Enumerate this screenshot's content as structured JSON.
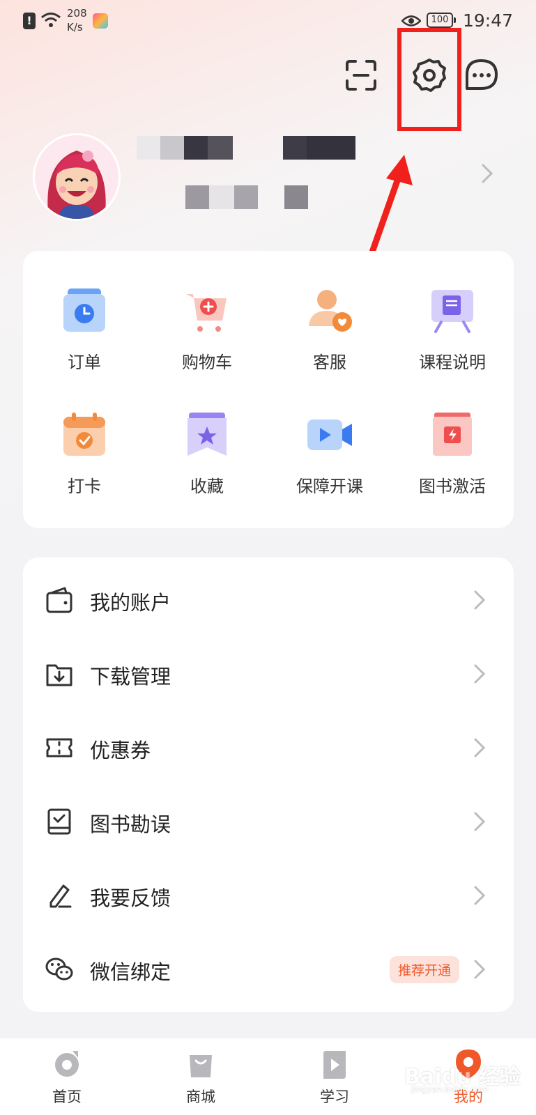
{
  "status_bar": {
    "net_speed_value": "208",
    "net_speed_unit": "K/s",
    "battery": "100",
    "time": "19:47"
  },
  "header": {
    "icons": [
      "scan-icon",
      "settings-icon",
      "message-icon"
    ]
  },
  "quick_grid": {
    "items": [
      {
        "label": "订单",
        "icon": "order-icon"
      },
      {
        "label": "购物车",
        "icon": "cart-icon"
      },
      {
        "label": "客服",
        "icon": "customer-service-icon"
      },
      {
        "label": "课程说明",
        "icon": "course-info-icon"
      },
      {
        "label": "打卡",
        "icon": "checkin-icon"
      },
      {
        "label": "收藏",
        "icon": "favorite-icon"
      },
      {
        "label": "保障开课",
        "icon": "video-icon"
      },
      {
        "label": "图书激活",
        "icon": "book-activate-icon"
      }
    ]
  },
  "menu": {
    "items": [
      {
        "label": "我的账户",
        "icon": "wallet-icon"
      },
      {
        "label": "下载管理",
        "icon": "download-icon"
      },
      {
        "label": "优惠券",
        "icon": "coupon-icon"
      },
      {
        "label": "图书勘误",
        "icon": "book-check-icon"
      },
      {
        "label": "我要反馈",
        "icon": "edit-icon"
      },
      {
        "label": "微信绑定",
        "icon": "wechat-icon",
        "badge": "推荐开通"
      }
    ]
  },
  "tabbar": {
    "tabs": [
      {
        "label": "首页",
        "icon": "home-icon"
      },
      {
        "label": "商城",
        "icon": "shop-bag-icon"
      },
      {
        "label": "学习",
        "icon": "play-icon"
      },
      {
        "label": "我的",
        "icon": "profile-icon",
        "active": true
      }
    ]
  },
  "watermark": {
    "text": "Baidu 经验",
    "subtext": "jingyan.baidu.com"
  },
  "colors": {
    "accent": "#f0582a",
    "highlight": "#f0211c"
  }
}
